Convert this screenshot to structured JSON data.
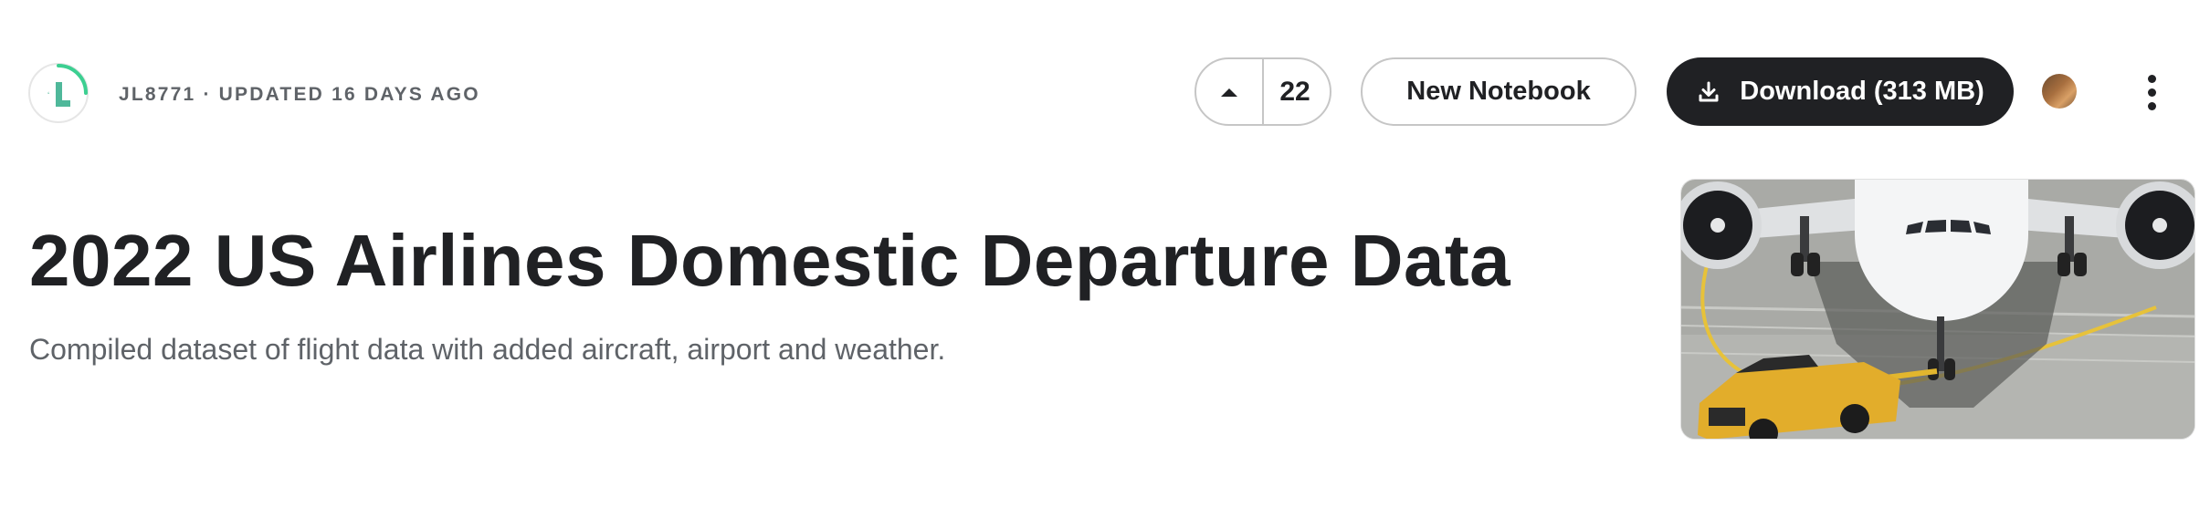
{
  "dataset": {
    "owner_line": "JL8771 · UPDATED 16 DAYS AGO",
    "title": "2022 US Airlines Domestic Departure Data",
    "subtitle": "Compiled dataset of flight data with added aircraft, airport and weather."
  },
  "actions": {
    "upvote_count": "22",
    "new_notebook_label": "New Notebook",
    "download_label": "Download (313 MB)"
  },
  "icons": {
    "owner_avatar": "owner-avatar-icon",
    "upvote": "caret-up-icon",
    "download": "download-icon",
    "more": "more-vertical-icon"
  },
  "colors": {
    "primary_button": "#202124",
    "text_primary": "#202124",
    "text_secondary": "#5f6368",
    "border": "#c6c6c6",
    "accent_green": "#20beff"
  }
}
